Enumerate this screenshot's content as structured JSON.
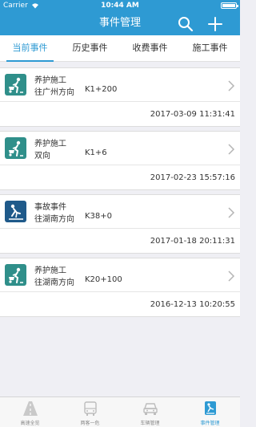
{
  "status_bar": {
    "carrier": "Carrier",
    "time": "10:44 AM"
  },
  "nav": {
    "title": "事件管理"
  },
  "tabs": [
    {
      "label": "当前事件",
      "active": true
    },
    {
      "label": "历史事件",
      "active": false
    },
    {
      "label": "收费事件",
      "active": false
    },
    {
      "label": "施工事件",
      "active": false
    }
  ],
  "events": [
    {
      "type": "养护施工",
      "direction": "往广州方向",
      "km": "K1+200",
      "time": "2017-03-09 11:31:41",
      "icon": "road-work-icon",
      "color": "#2f8f8a"
    },
    {
      "type": "养护施工",
      "direction": "双向",
      "km": "K1+6",
      "time": "2017-02-23 15:57:16",
      "icon": "road-work-icon",
      "color": "#2f8f8a"
    },
    {
      "type": "事故事件",
      "direction": "往湖南方向",
      "km": "K38+0",
      "time": "2017-01-18 20:11:31",
      "icon": "accident-icon",
      "color": "#1f5a8a"
    },
    {
      "type": "养护施工",
      "direction": "往湖南方向",
      "km": "K20+100",
      "time": "2016-12-13 10:20:55",
      "icon": "road-work-icon",
      "color": "#2f8f8a"
    }
  ],
  "tabbar": [
    {
      "label": "高速全览",
      "icon": "highway-icon",
      "active": false
    },
    {
      "label": "两客一危",
      "icon": "bus-icon",
      "active": false
    },
    {
      "label": "车辆管理",
      "icon": "car-icon",
      "active": false
    },
    {
      "label": "事件管理",
      "icon": "event-icon",
      "active": true
    }
  ],
  "colors": {
    "primary": "#2e9ad3",
    "background": "#efeff4",
    "maintenance": "#2f8f8a",
    "accident": "#1f5a8a"
  }
}
